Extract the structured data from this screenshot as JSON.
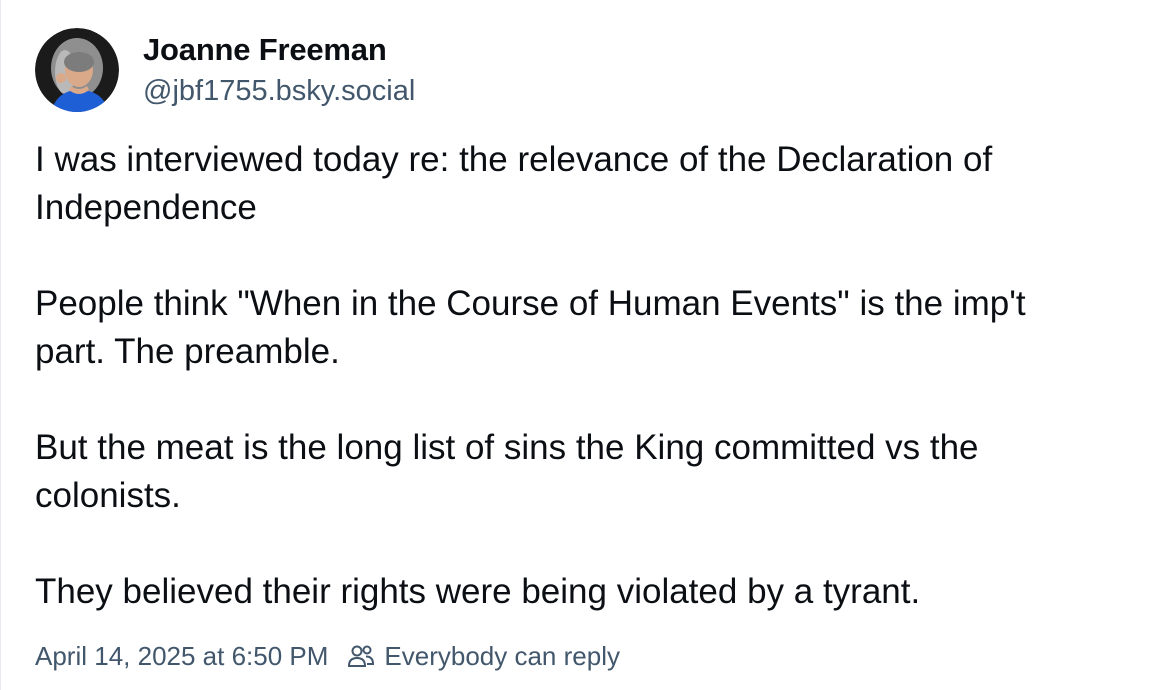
{
  "author": {
    "display_name": "Joanne Freeman",
    "handle": "@jbf1755.bsky.social",
    "avatar": "profile-photo"
  },
  "post": {
    "paragraphs": [
      [
        "I was interviewed today re: the relevance of the Declaration of",
        "Independence"
      ],
      [
        "People think \"When in the Course of Human Events\" is the imp't",
        "part. The preamble."
      ],
      [
        "But the meat is the long list of sins the King committed vs the",
        "colonists."
      ],
      [
        "They believed their rights were being violated by a tyrant."
      ]
    ]
  },
  "meta": {
    "timestamp": "April 14, 2025 at 6:50 PM",
    "reply_setting": "Everybody can reply",
    "reply_icon": "people-icon"
  },
  "colors": {
    "text": "#0b0f14",
    "muted": "#42576c",
    "avatar_shirt": "#1f5fd6"
  }
}
